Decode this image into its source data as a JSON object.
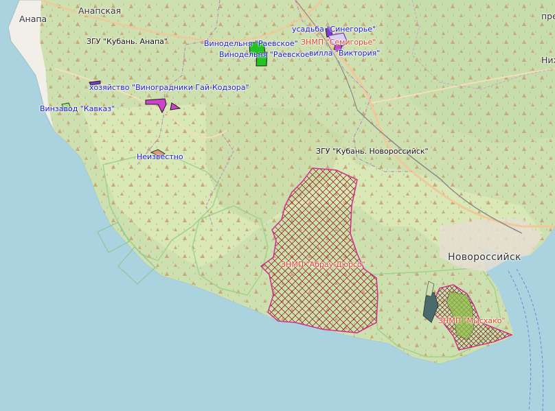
{
  "map": {
    "colors": {
      "sea": "#aad3df",
      "land": "#f2efe9",
      "forest": "#c8dcae",
      "meadow": "#d6e6b2",
      "vineyard": "#cfe6a2",
      "park_fill": "#8b1a1a",
      "park_border": "#d02090",
      "admin_border": "#b58fb5",
      "road": "#f0c89a",
      "rail": "#8a8a8a",
      "lilac": "#cc44cc",
      "green_obj": "#22c322"
    },
    "places": {
      "anapskaya": "Анапская",
      "anapa": "Анапа",
      "novorossiysk": "Новороссийск",
      "nizh": "Ниж",
      "pre": "пре"
    },
    "labels": {
      "zgu_anapa": "ЗГУ \"Кубань. Анапа\"",
      "zgu_novoross": "ЗГУ \"Кубань. Новороссийск\"",
      "vinodelnya_1": "Винодельня \"Раевское\"",
      "vinodelnya_2": "Винодельня \"Раевское\"",
      "usadba": "усадьба \"Синегорье\"",
      "znmp_semigorye": "ЗНМП \"Семигорье\"",
      "villa": "вилла \"Виктория\"",
      "khozyaystvo": "хозяйство \"Виноградники Гай-Кодзора\"",
      "vinzavod": "Винзавод \"Кавказ\"",
      "neizvestno": "Неизвестно",
      "znmp_abrau": "ЗНМП \"Абрау-Дюрсо\"",
      "znmp_myskhako": "ЗНМП \"Мысхако\""
    }
  }
}
